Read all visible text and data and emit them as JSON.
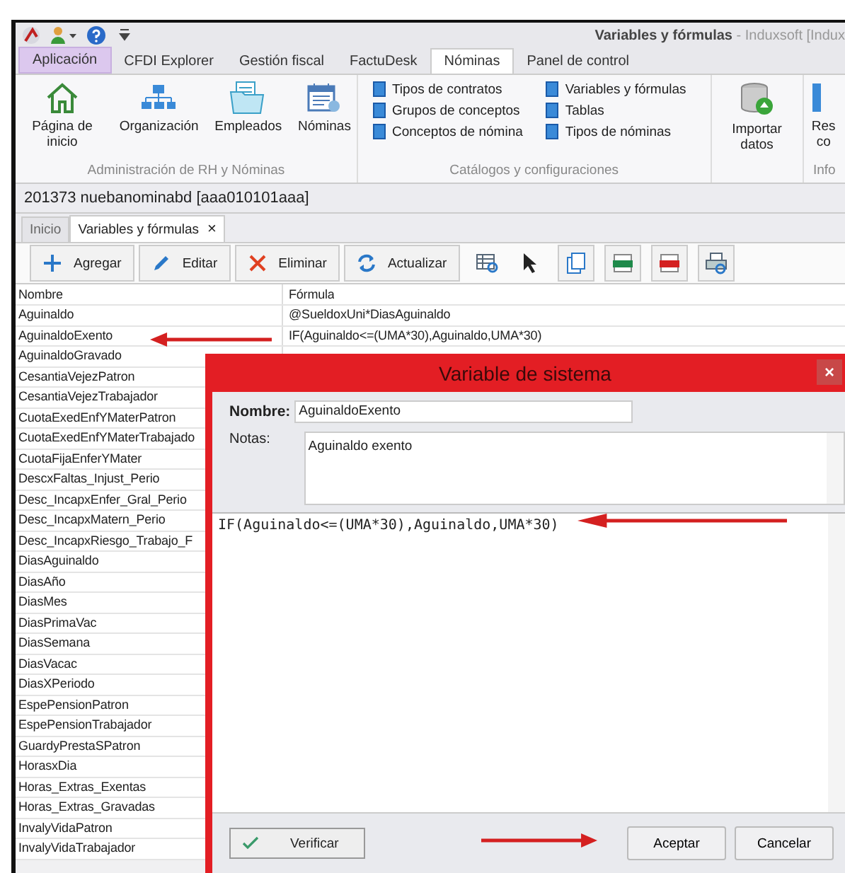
{
  "window": {
    "title": "Variables y fórmulas",
    "title_suffix": " - Induxsoft [Indux"
  },
  "ribbon_tabs": [
    {
      "label": "Aplicación",
      "kind": "app",
      "selected": false
    },
    {
      "label": "CFDI Explorer",
      "kind": "tab",
      "selected": false
    },
    {
      "label": "Gestión fiscal",
      "kind": "tab",
      "selected": false
    },
    {
      "label": "FactuDesk",
      "kind": "tab",
      "selected": false
    },
    {
      "label": "Nóminas",
      "kind": "tab",
      "selected": true
    },
    {
      "label": "Panel de control",
      "kind": "tab",
      "selected": false
    }
  ],
  "ribbon_groups": [
    {
      "label": "Administración de RH y Nóminas",
      "kind": "large",
      "items": [
        {
          "label": "Página de inicio"
        },
        {
          "label": "Organización"
        },
        {
          "label": "Empleados"
        },
        {
          "label": "Nóminas"
        }
      ]
    },
    {
      "label": "Catálogos y configuraciones",
      "kind": "small",
      "columns": [
        [
          "Tipos de contratos",
          "Grupos de conceptos",
          "Conceptos de nómina"
        ],
        [
          "Variables y fórmulas",
          "Tablas",
          "Tipos de nóminas"
        ]
      ]
    },
    {
      "kind": "large",
      "items": [
        {
          "label": "Importar datos"
        }
      ]
    },
    {
      "label": "Info",
      "kind": "large",
      "items": [
        {
          "label": "Res co"
        }
      ]
    }
  ],
  "document_title": "201373 nuebanominabd [aaa010101aaa]",
  "doc_tabs": [
    {
      "label": "Inicio",
      "selected": false
    },
    {
      "label": "Variables y fórmulas",
      "selected": true,
      "close": "×"
    }
  ],
  "toolbar": [
    {
      "kind": "text",
      "label": "Agregar"
    },
    {
      "kind": "text",
      "label": "Editar"
    },
    {
      "kind": "text",
      "label": "Eliminar"
    },
    {
      "kind": "text",
      "label": "Actualizar"
    },
    {
      "kind": "icon"
    },
    {
      "kind": "icon"
    },
    {
      "kind": "icon"
    },
    {
      "kind": "icon"
    },
    {
      "kind": "icon"
    },
    {
      "kind": "icon"
    }
  ],
  "table": {
    "columns": [
      "Nombre",
      "Fórmula"
    ],
    "rows": [
      [
        "Aguinaldo",
        "@SueldoxUni*DiasAguinaldo"
      ],
      [
        "AguinaldoExento",
        "IF(Aguinaldo<=(UMA*30),Aguinaldo,UMA*30)"
      ],
      [
        "AguinaldoGravado"
      ],
      [
        "CesantiaVejezPatron"
      ],
      [
        "CesantiaVejezTrabajador"
      ],
      [
        "CuotaExedEnfYMaterPatron"
      ],
      [
        "CuotaExedEnfYMaterTrabajado"
      ],
      [
        "CuotaFijaEnferYMater"
      ],
      [
        "DescxFaltas_Injust_Perio"
      ],
      [
        "Desc_IncapxEnfer_Gral_Perio"
      ],
      [
        "Desc_IncapxMatern_Perio"
      ],
      [
        "Desc_IncapxRiesgo_Trabajo_F"
      ],
      [
        "DiasAguinaldo"
      ],
      [
        "DiasAño"
      ],
      [
        "DiasMes"
      ],
      [
        "DiasPrimaVac"
      ],
      [
        "DiasSemana"
      ],
      [
        "DiasVacac"
      ],
      [
        "DiasXPeriodo"
      ],
      [
        "EspePensionPatron"
      ],
      [
        "EspePensionTrabajador"
      ],
      [
        "GuardyPrestaSPatron"
      ],
      [
        "HorasxDia"
      ],
      [
        "Horas_Extras_Exentas"
      ],
      [
        "Horas_Extras_Gravadas"
      ],
      [
        "InvalyVidaPatron"
      ],
      [
        "InvalyVidaTrabajador"
      ]
    ]
  },
  "dialog": {
    "title": "Variable de sistema",
    "close": "×",
    "name_label": "Nombre:",
    "name_value": "AguinaldoExento",
    "notes_label": "Notas:",
    "notes_value": "Aguinaldo exento",
    "formula": "IF(Aguinaldo<=(UMA*30),Aguinaldo,UMA*30)",
    "verify": "Verificar",
    "buttons": [
      "Aceptar",
      "Cancelar"
    ]
  }
}
